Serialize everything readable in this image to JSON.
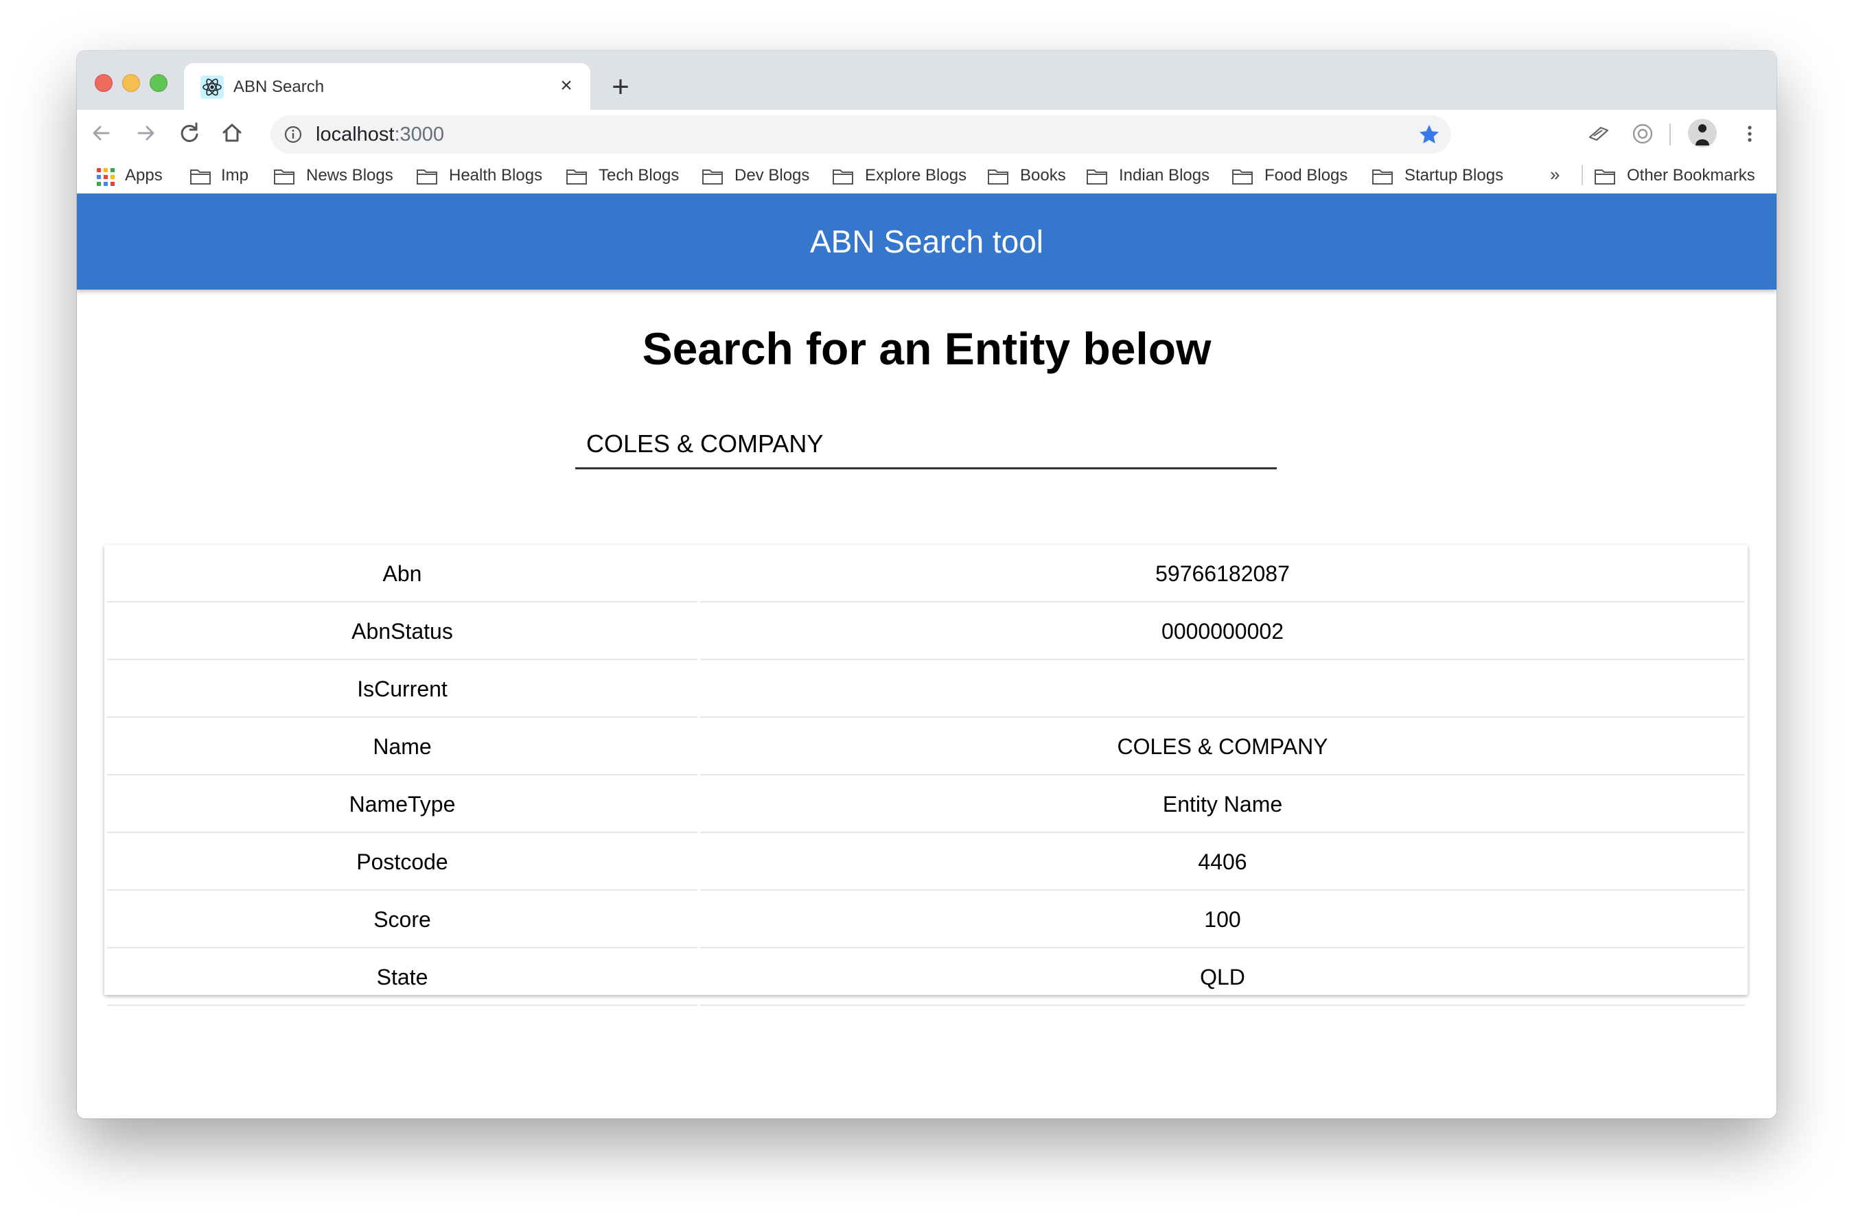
{
  "browser": {
    "tab_title": "ABN Search",
    "url_host": "localhost",
    "url_port": ":3000",
    "bookmarks": [
      {
        "label": "Apps",
        "icon": "apps-grid-icon"
      },
      {
        "label": "Imp",
        "icon": "folder-icon"
      },
      {
        "label": "News Blogs",
        "icon": "folder-icon"
      },
      {
        "label": "Health Blogs",
        "icon": "folder-icon"
      },
      {
        "label": "Tech Blogs",
        "icon": "folder-icon"
      },
      {
        "label": "Dev Blogs",
        "icon": "folder-icon"
      },
      {
        "label": "Explore Blogs",
        "icon": "folder-icon"
      },
      {
        "label": "Books",
        "icon": "folder-icon"
      },
      {
        "label": "Indian Blogs",
        "icon": "folder-icon"
      },
      {
        "label": "Food Blogs",
        "icon": "folder-icon"
      },
      {
        "label": "Startup Blogs",
        "icon": "folder-icon"
      }
    ],
    "overflow_label": "»",
    "other_bookmarks": "Other Bookmarks"
  },
  "app": {
    "title": "ABN Search tool",
    "heading": "Search for an Entity below",
    "search_value": "COLES & COMPANY",
    "accent_color": "#3477cd"
  },
  "results": [
    {
      "key": "Abn",
      "value": "59766182087"
    },
    {
      "key": "AbnStatus",
      "value": "0000000002"
    },
    {
      "key": "IsCurrent",
      "value": ""
    },
    {
      "key": "Name",
      "value": "COLES & COMPANY"
    },
    {
      "key": "NameType",
      "value": "Entity Name"
    },
    {
      "key": "Postcode",
      "value": "4406"
    },
    {
      "key": "Score",
      "value": "100"
    },
    {
      "key": "State",
      "value": "QLD"
    }
  ]
}
